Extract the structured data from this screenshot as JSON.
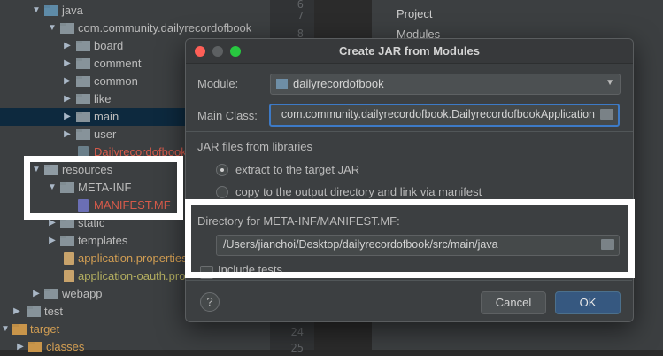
{
  "project_tree": {
    "items": [
      {
        "label": "java"
      },
      {
        "label": "com.community.dailyrecordofbook"
      },
      {
        "label": "board"
      },
      {
        "label": "comment"
      },
      {
        "label": "common"
      },
      {
        "label": "like"
      },
      {
        "label": "main"
      },
      {
        "label": "user"
      },
      {
        "label": "Dailyrecordofbook"
      },
      {
        "label": "resources"
      },
      {
        "label": "META-INF"
      },
      {
        "label": "MANIFEST.MF"
      },
      {
        "label": "static"
      },
      {
        "label": "templates"
      },
      {
        "label": "application.properties"
      },
      {
        "label": "application-oauth.properties"
      },
      {
        "label": "webapp"
      },
      {
        "label": "test"
      },
      {
        "label": "target"
      },
      {
        "label": "classes"
      }
    ]
  },
  "gutter": {
    "lines": [
      "6",
      "7",
      "8",
      "24",
      "25"
    ]
  },
  "right_panel": {
    "items": [
      "Project",
      "Modules"
    ]
  },
  "dialog": {
    "title": "Create JAR from Modules",
    "module_label": "Module:",
    "module_value": "dailyrecordofbook",
    "main_class_label": "Main Class:",
    "main_class_value": "com.community.dailyrecordofbook.DailyrecordofbookApplication",
    "jar_section_label": "JAR files from libraries",
    "radio_extract": "extract to the target JAR",
    "radio_copy": "copy to the output directory and link via manifest",
    "manifest_dir_label": "Directory for META-INF/MANIFEST.MF:",
    "manifest_dir_value": "/Users/jianchoi/Desktop/dailyrecordofbook/src/main/java",
    "include_tests_label": "Include tests",
    "help_label": "?",
    "cancel_label": "Cancel",
    "ok_label": "OK"
  },
  "colors": {
    "accent_blue": "#3d7ac6",
    "ok_button": "#365880",
    "highlight_box": "#ffffff",
    "close_light": "#fe5f57",
    "max_light": "#28c840"
  }
}
